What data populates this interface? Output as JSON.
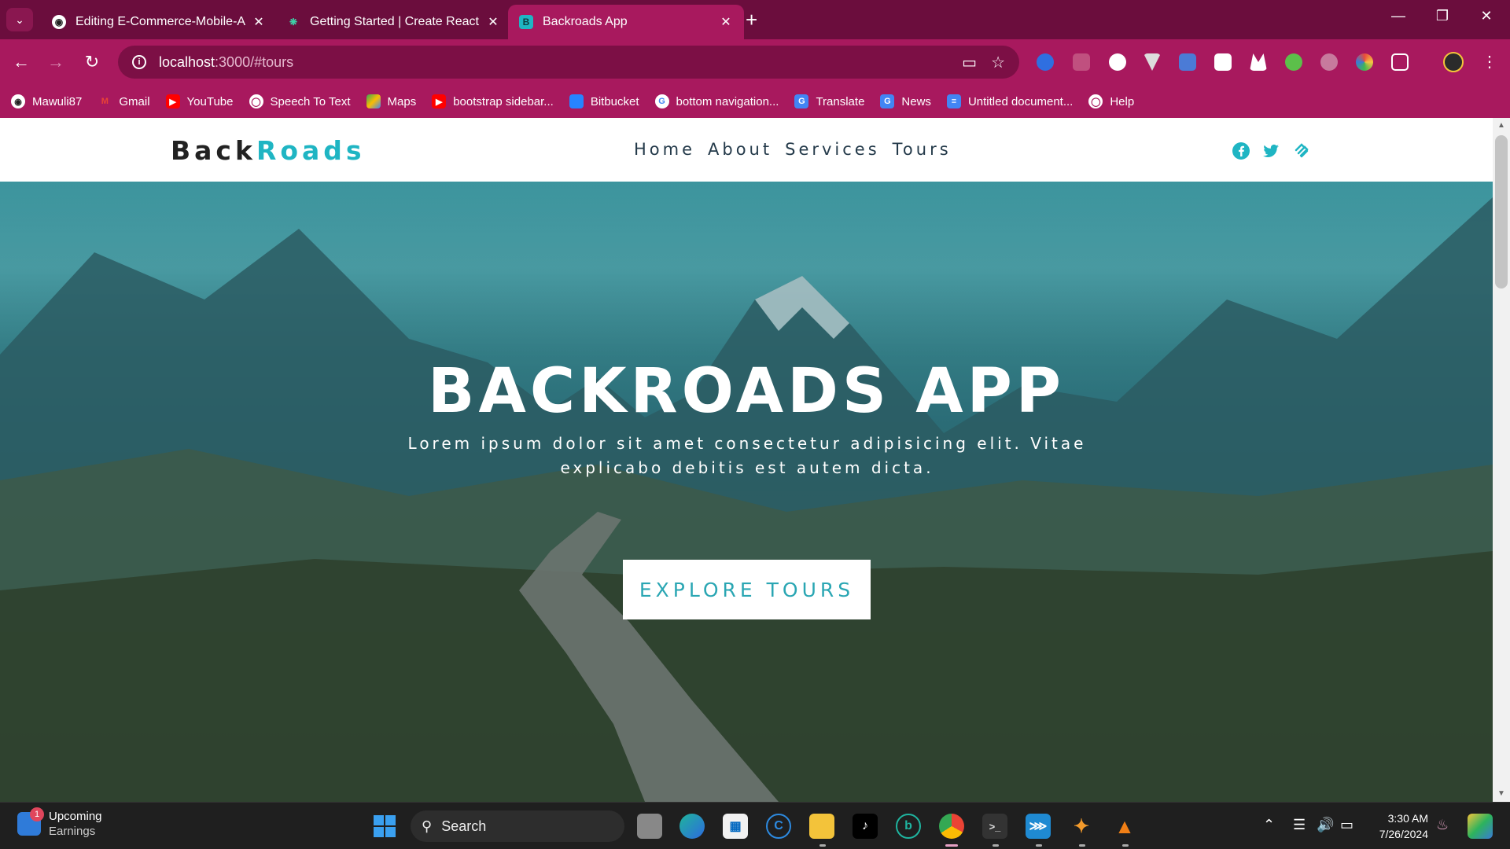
{
  "browser": {
    "tabs": [
      {
        "title": "Editing E-Commerce-Mobile-Ap",
        "icon": "github-icon",
        "active": false
      },
      {
        "title": "Getting Started | Create React A",
        "icon": "react-icon",
        "active": false
      },
      {
        "title": "Backroads App",
        "icon": "bootstrap-icon",
        "active": true
      }
    ],
    "new_tab": "+",
    "address": {
      "host": "localhost",
      "path": ":3000/#tours"
    },
    "bookmarks": [
      {
        "label": "Mawuli87",
        "icon": "github-icon"
      },
      {
        "label": "Gmail",
        "icon": "gmail-icon"
      },
      {
        "label": "YouTube",
        "icon": "youtube-icon"
      },
      {
        "label": "Speech To Text",
        "icon": "globe-icon"
      },
      {
        "label": "Maps",
        "icon": "maps-icon"
      },
      {
        "label": "bootstrap sidebar...",
        "icon": "youtube-icon"
      },
      {
        "label": "Bitbucket",
        "icon": "bitbucket-icon"
      },
      {
        "label": "bottom navigation...",
        "icon": "google-icon"
      },
      {
        "label": "Translate",
        "icon": "translate-icon"
      },
      {
        "label": "News",
        "icon": "news-icon"
      },
      {
        "label": "Untitled document...",
        "icon": "docs-icon"
      },
      {
        "label": "Help",
        "icon": "globe-icon"
      }
    ]
  },
  "site": {
    "logo_back": "Back",
    "logo_roads": "Roads",
    "nav": [
      "Home",
      "About",
      "Services",
      "Tours"
    ],
    "social": [
      "facebook-icon",
      "twitter-icon",
      "squarespace-icon"
    ],
    "hero": {
      "title": "BACKROADS APP",
      "subtitle": "Lorem ipsum dolor sit amet consectetur adipisicing elit. Vitae explicabo debitis est autem dicta.",
      "button": "EXPLORE TOURS"
    }
  },
  "taskbar": {
    "widget_title": "Upcoming",
    "widget_sub": "Earnings",
    "widget_badge": "1",
    "search_placeholder": "Search",
    "time": "3:30 AM",
    "date": "7/26/2024"
  },
  "colors": {
    "chrome_frame": "#6b0d3d",
    "chrome_toolbar": "#a8195e",
    "accent_teal": "#1fb5c3"
  }
}
